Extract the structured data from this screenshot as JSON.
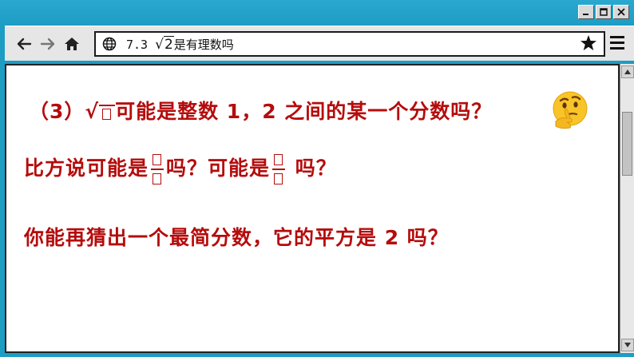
{
  "window": {
    "controls": {
      "minimize": "_",
      "maximize": "□",
      "close": "✕"
    }
  },
  "toolbar": {
    "back_icon": "arrow-left-icon",
    "forward_icon": "arrow-right-icon",
    "home_icon": "home-icon",
    "globe_icon": "globe-icon",
    "address_prefix": "7.3 ",
    "address_radicand": "2",
    "address_suffix": "是有理数吗",
    "bookmark_icon": "star-icon",
    "menu_icon": "hamburger-menu-icon"
  },
  "content": {
    "line1_prefix": "（3）",
    "line1_rest": "可能是整数 1，2 之间的某一个分数吗？",
    "line2_a": "比方说可能是",
    "line2_b": "吗？可能是",
    "line2_c": " 吗？",
    "line3": "你能再猜出一个最简分数，它的平方是 2 吗？"
  },
  "colors": {
    "text_red": "#b50c0c",
    "window_blue": "#1d9cc4"
  }
}
